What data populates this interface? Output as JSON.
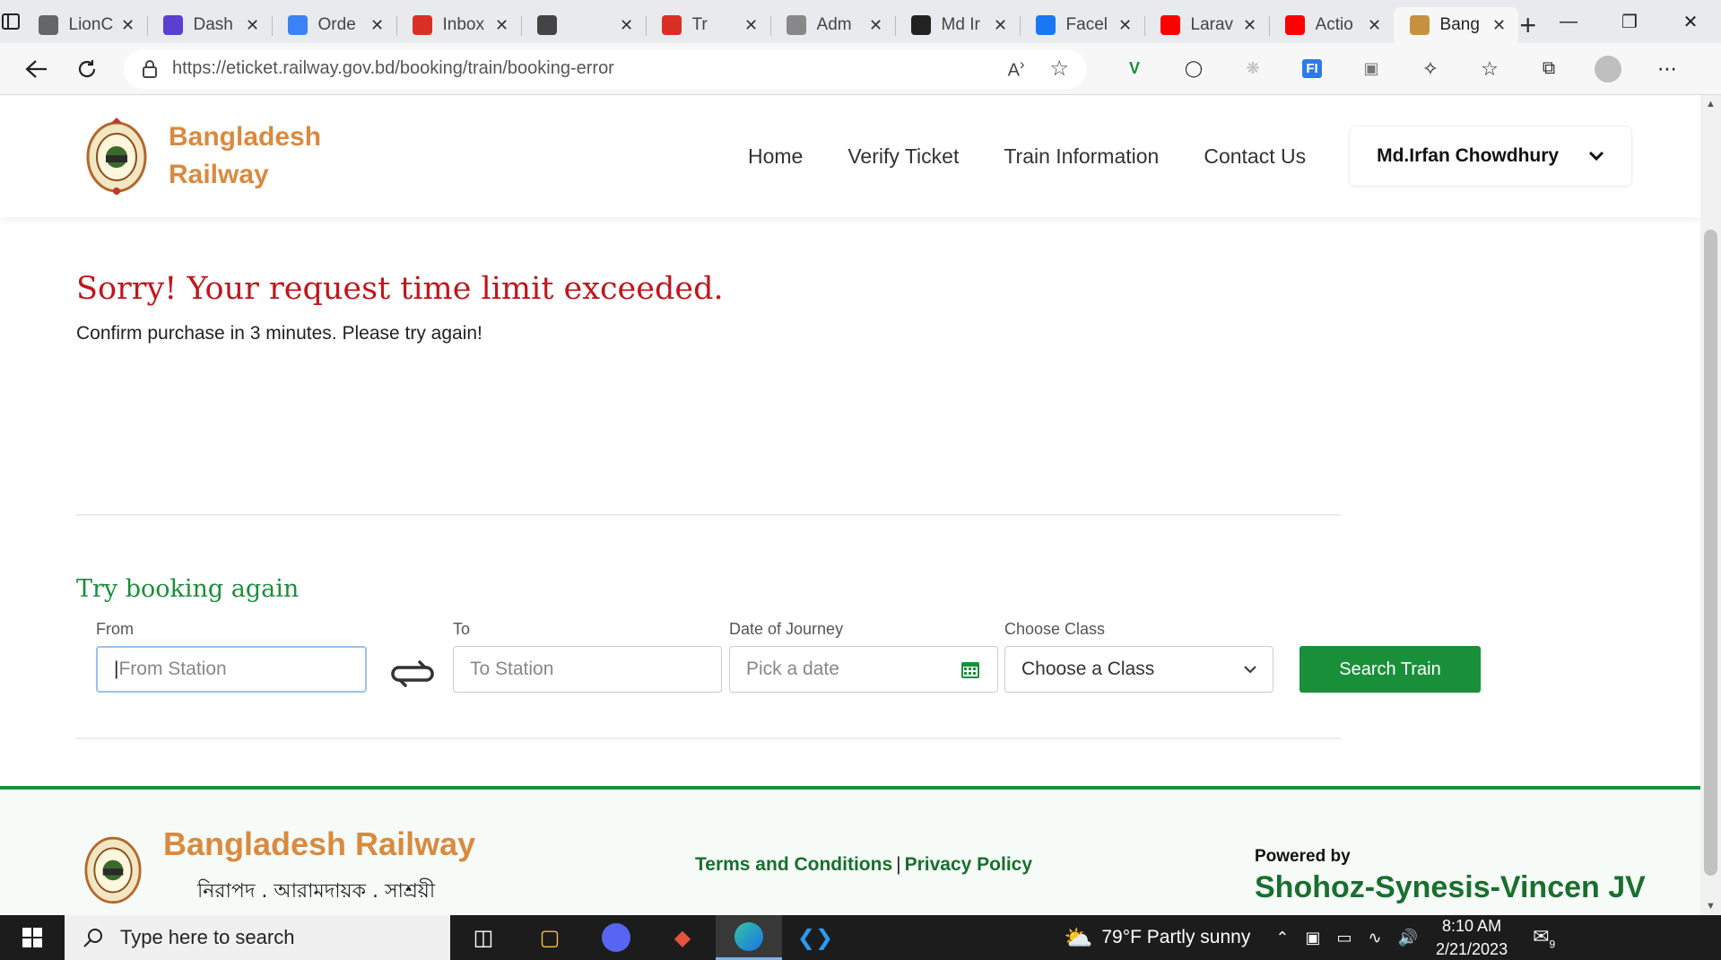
{
  "browser": {
    "tabs": [
      {
        "title": "LionC",
        "icon": "heart-shield-icon",
        "color": "#666666"
      },
      {
        "title": "Dash",
        "icon": "h-logo-icon",
        "color": "#5b3fd1"
      },
      {
        "title": "Orde",
        "icon": "globe-icon",
        "color": "#3b82f6"
      },
      {
        "title": "Inbox",
        "icon": "gmail-icon",
        "color": "#d93025"
      },
      {
        "title": "",
        "icon": "document-icon",
        "color": "#444444"
      },
      {
        "title": "Tr",
        "icon": "pencil-icon",
        "color": "#d93025"
      },
      {
        "title": "Adm",
        "icon": "ohs-icon",
        "color": "#888888"
      },
      {
        "title": "Md Ir",
        "icon": "notion-icon",
        "color": "#222222"
      },
      {
        "title": "Facel",
        "icon": "facebook-icon",
        "color": "#1877f2"
      },
      {
        "title": "Larav",
        "icon": "youtube-icon",
        "color": "#ff0000"
      },
      {
        "title": "Actio",
        "icon": "youtube-icon",
        "color": "#ff0000"
      },
      {
        "title": "Bang",
        "icon": "railway-logo-icon",
        "color": "#c8913f",
        "active": true
      }
    ],
    "url_host": "https://eticket.railway.gov.bd",
    "url_path": "/booking/train/booking-error"
  },
  "site": {
    "brand_line1": "Bangladesh",
    "brand_line2": "Railway",
    "nav": [
      "Home",
      "Verify Ticket",
      "Train Information",
      "Contact Us"
    ],
    "user_name": "Md.Irfan Chowdhury"
  },
  "error": {
    "title": "Sorry! Your request time limit exceeded.",
    "message": "Confirm purchase in 3 minutes. Please try again!"
  },
  "booking": {
    "heading": "Try booking again",
    "from_label": "From",
    "from_placeholder": "From Station",
    "to_label": "To",
    "to_placeholder": "To Station",
    "date_label": "Date of Journey",
    "date_placeholder": "Pick a date",
    "class_label": "Choose Class",
    "class_value": "Choose a Class",
    "search_button": "Search Train"
  },
  "footer": {
    "brand": "Bangladesh Railway",
    "tagline": "নিরাপদ . আরামদায়ক . সাশ্রয়ী",
    "terms": "Terms and Conditions",
    "separator": "|",
    "privacy": "Privacy Policy",
    "powered_by": "Powered by",
    "company": "Shohoz-Synesis-Vincen JV"
  },
  "taskbar": {
    "search_placeholder": "Type here to search",
    "weather": "79°F  Partly sunny",
    "time": "8:10 AM",
    "date": "2/21/2023",
    "notifications": "9"
  },
  "colors": {
    "brand_orange": "#d98a3f",
    "brand_green": "#1a8f3a",
    "error_red": "#c0161c"
  }
}
